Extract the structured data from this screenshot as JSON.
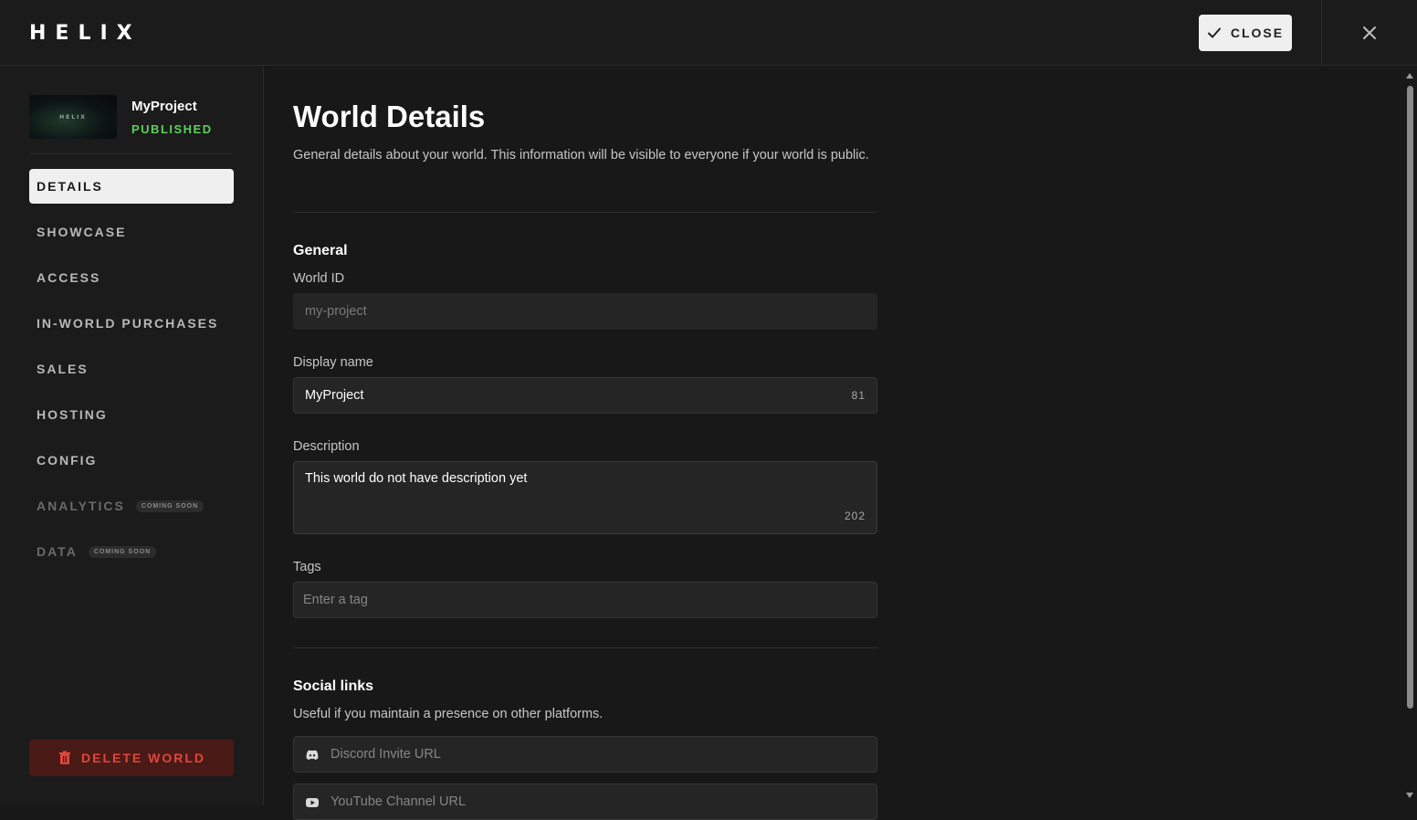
{
  "app": {
    "logo_text": "HELIX"
  },
  "header": {
    "close_label": "CLOSE"
  },
  "project": {
    "name": "MyProject",
    "status": "PUBLISHED",
    "thumb_text": "HELIX"
  },
  "nav": {
    "items": [
      {
        "label": "DETAILS",
        "active": true
      },
      {
        "label": "SHOWCASE"
      },
      {
        "label": "ACCESS"
      },
      {
        "label": "IN-WORLD PURCHASES"
      },
      {
        "label": "SALES"
      },
      {
        "label": "HOSTING"
      },
      {
        "label": "CONFIG"
      },
      {
        "label": "ANALYTICS",
        "badge": "COMING SOON",
        "disabled": true
      },
      {
        "label": "DATA",
        "badge": "COMING SOON",
        "disabled": true
      }
    ],
    "delete_label": "DELETE WORLD"
  },
  "main": {
    "title": "World Details",
    "subtitle": "General details about your world. This information will be visible to everyone if your world is public.",
    "general": {
      "title": "General",
      "world_id_label": "World ID",
      "world_id_value": "my-project",
      "display_name_label": "Display name",
      "display_name_value": "MyProject",
      "display_name_counter": "81",
      "description_label": "Description",
      "description_value": "This world do not have description yet",
      "description_counter": "202",
      "tags_label": "Tags",
      "tags_placeholder": "Enter a tag"
    },
    "social": {
      "title": "Social links",
      "subtitle": "Useful if you maintain a presence on other platforms.",
      "discord_placeholder": "Discord Invite URL",
      "youtube_placeholder": "YouTube Channel URL"
    }
  },
  "colors": {
    "accent_green": "#5bd05b",
    "danger_red": "#e0463b",
    "danger_bg": "#4a1a17"
  },
  "icons": {
    "close_button": "check-icon",
    "dismiss": "x-icon",
    "delete": "trash-icon",
    "discord": "discord-icon",
    "youtube": "youtube-icon"
  }
}
